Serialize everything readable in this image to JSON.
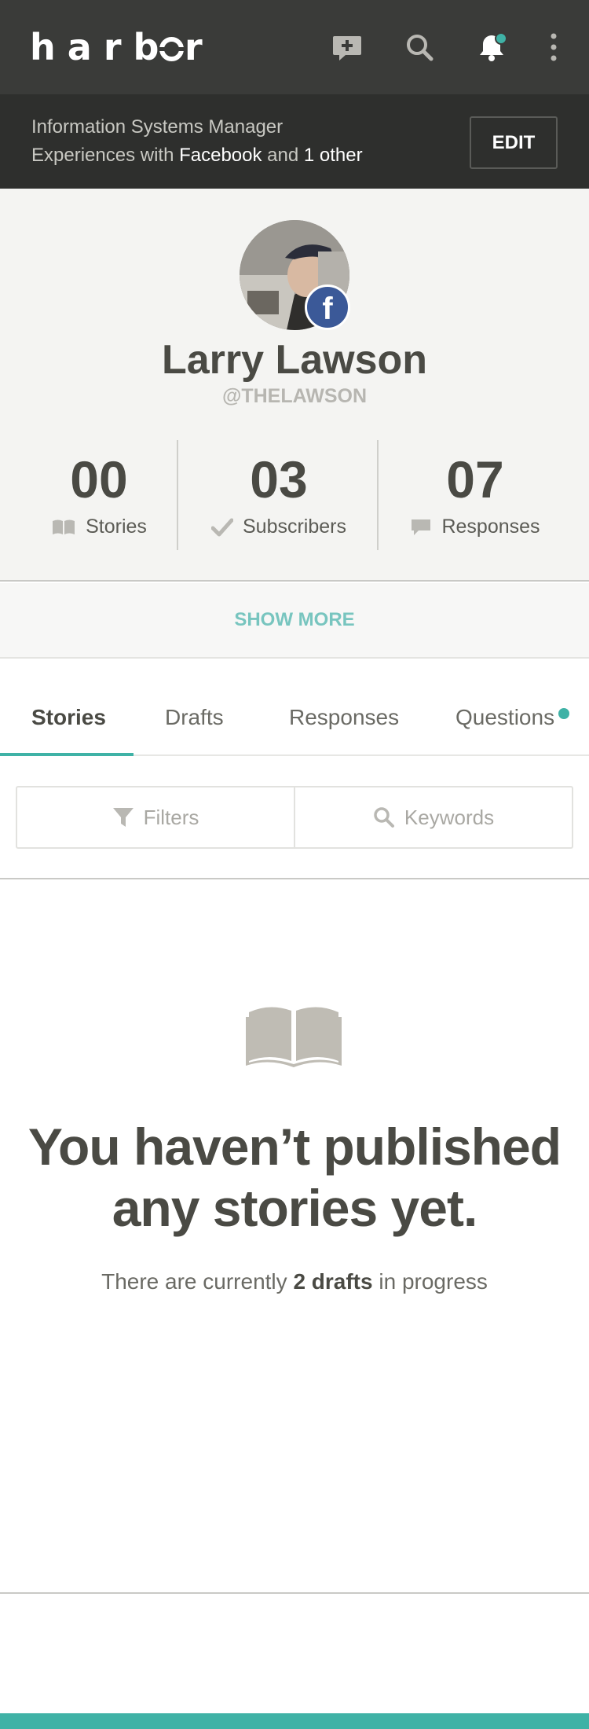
{
  "header": {
    "logo": "harbor",
    "icons": [
      "compose-icon",
      "search-icon",
      "bell-icon",
      "more-vertical-icon"
    ],
    "notification_dot_color": "#3fb2a6"
  },
  "bio": {
    "title": "Information Systems Manager",
    "experiences_prefix": "Experiences with",
    "experiences_main": "Facebook",
    "experiences_and": "and",
    "experiences_other": "1 other",
    "edit_label": "EDIT"
  },
  "profile": {
    "name": "Larry Lawson",
    "handle": "@THELAWSON",
    "badge_letter": "f",
    "stats": [
      {
        "value": "00",
        "label": "Stories",
        "icon": "book-icon"
      },
      {
        "value": "03",
        "label": "Subscribers",
        "icon": "check-icon"
      },
      {
        "value": "07",
        "label": "Responses",
        "icon": "speech-bubble-icon"
      }
    ],
    "show_more": "SHOW MORE"
  },
  "tabs": {
    "items": [
      "Stories",
      "Drafts",
      "Responses",
      "Questions"
    ],
    "active": "Stories"
  },
  "filters": {
    "filter_label": "Filters",
    "keyword_label": "Keywords"
  },
  "empty_state": {
    "title_line1": "You haven’t published",
    "title_line2": "any stories yet.",
    "sub_prefix": "There are currently",
    "sub_bold": "2 drafts",
    "sub_suffix": "in progress"
  },
  "colors": {
    "accent": "#3fb2a6",
    "header_bg": "#3a3b39",
    "facebook": "#3b5998"
  }
}
